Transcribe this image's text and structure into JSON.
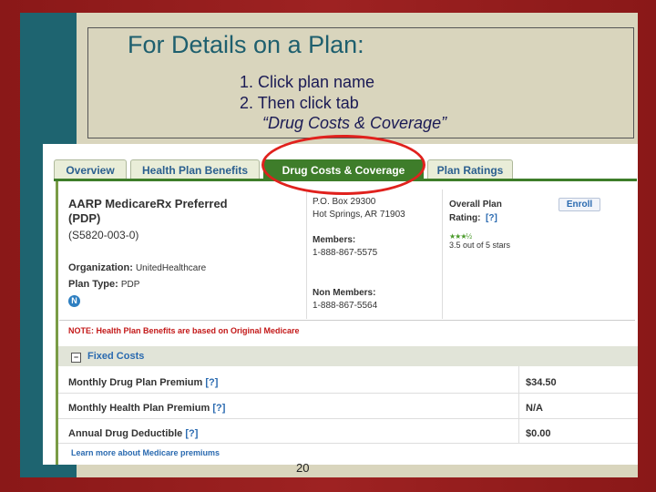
{
  "slide": {
    "title": "For Details on a Plan:",
    "step1": "1. Click plan name",
    "step2": "2. Then click  tab",
    "step3": "“Drug Costs & Coverage”",
    "page_number": "20"
  },
  "tabs": [
    {
      "label": "Overview"
    },
    {
      "label": "Health Plan Benefits"
    },
    {
      "label": "Drug Costs & Coverage"
    },
    {
      "label": "Plan Ratings"
    }
  ],
  "plan": {
    "name_line1": "AARP MedicareRx Preferred",
    "name_line2": "(PDP)",
    "id": "(S5820-003-0)",
    "org_label": "Organization:",
    "org_value": "UnitedHealthcare",
    "type_label": "Plan Type:",
    "type_value": "PDP",
    "badge": "N",
    "address_line1": "P.O. Box 29300",
    "address_line2": "Hot Springs, AR 71903",
    "members_label": "Members:",
    "members_phone": "1-888-867-5575",
    "non_members_label": "Non Members:",
    "non_members_phone": "1-888-867-5564",
    "rating_label_line1": "Overall Plan",
    "rating_label_line2": "Rating:",
    "rating_help": "[?]",
    "rating_stars": "★★★½",
    "rating_text": "3.5 out of 5 stars",
    "rating_value": 3.5,
    "enroll_label": "Enroll"
  },
  "note": "NOTE: Health Plan Benefits are based on Original Medicare",
  "fixed_costs": {
    "toggle": "−",
    "label": "Fixed Costs",
    "rows": [
      {
        "label": "Monthly Drug Plan Premium",
        "help": "[?]",
        "value": "$34.50"
      },
      {
        "label": "Monthly Health Plan Premium",
        "help": "[?]",
        "value": "N/A"
      },
      {
        "label": "Annual Drug Deductible",
        "help": "[?]",
        "value": "$0.00"
      }
    ],
    "learn_more": "Learn more about Medicare premiums"
  },
  "colors": {
    "accent_teal": "#1e6470",
    "tab_active": "#3e7d2a",
    "highlight_ring": "#e0211d",
    "note_red": "#c31818"
  }
}
